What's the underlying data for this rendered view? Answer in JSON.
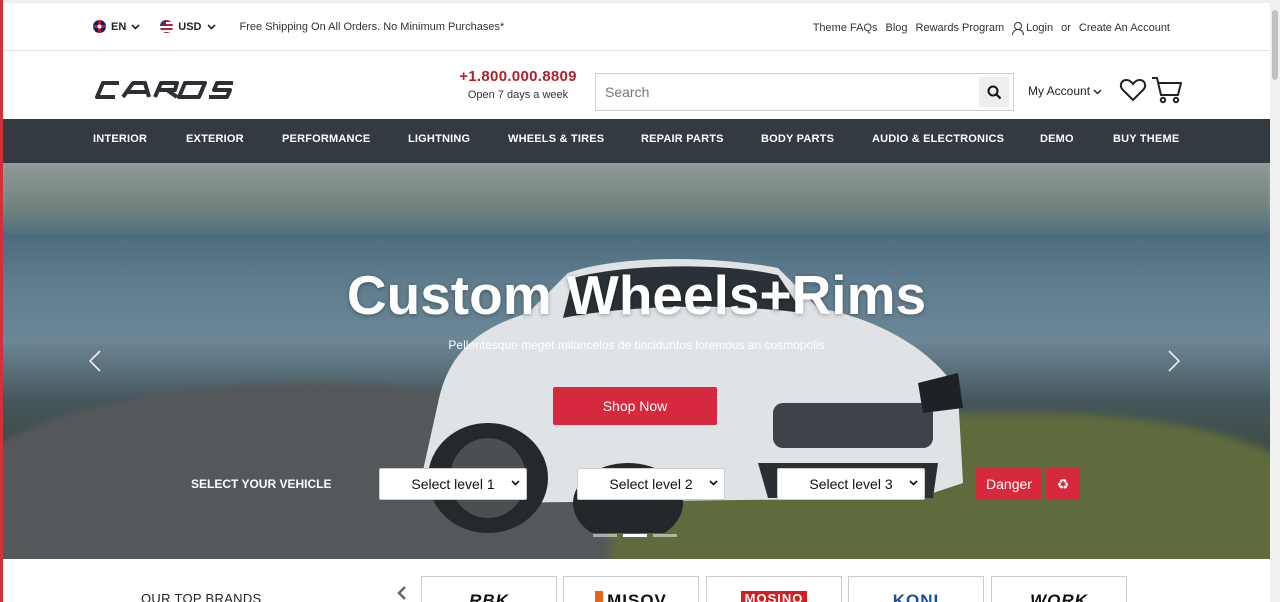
{
  "topbar": {
    "language": "EN",
    "currency": "USD",
    "shipping_text": "Free Shipping On All Orders. No Minimum Purchases*",
    "links": [
      "Theme FAQs",
      "Blog",
      "Rewards Program"
    ],
    "login": "Login",
    "or": "or",
    "create_account": "Create An Account"
  },
  "header": {
    "logo_text": "CAROS",
    "phone": "+1.800.000.8809",
    "phone_sub": "Open 7 days a week",
    "search_placeholder": "Search",
    "account_label": "My Account"
  },
  "nav": [
    "INTERIOR",
    "EXTERIOR",
    "PERFORMANCE",
    "LIGHTNING",
    "WHEELS & TIRES",
    "REPAIR PARTS",
    "BODY PARTS",
    "AUDIO & ELECTRONICS",
    "DEMO",
    "BUY THEME"
  ],
  "hero": {
    "title": "Custom Wheels+Rims",
    "subtitle": "Pellentesque meget milancelos de tinciduntos loremous an cosmopolis",
    "cta": "Shop Now",
    "vehicle_label": "SELECT YOUR VEHICLE",
    "selects": [
      "Select level 1",
      "Select level 2",
      "Select level 3"
    ],
    "danger_label": "Danger",
    "slide_count": 3,
    "active_slide": 2
  },
  "brands": {
    "title": "OUR TOP BRANDS",
    "items": [
      "RBK",
      "MISOV",
      "MOSINO",
      "KONI",
      "WORK"
    ]
  },
  "colors": {
    "accent": "#d7293d",
    "nav_bg": "#343a42",
    "phone": "#b3202c"
  }
}
